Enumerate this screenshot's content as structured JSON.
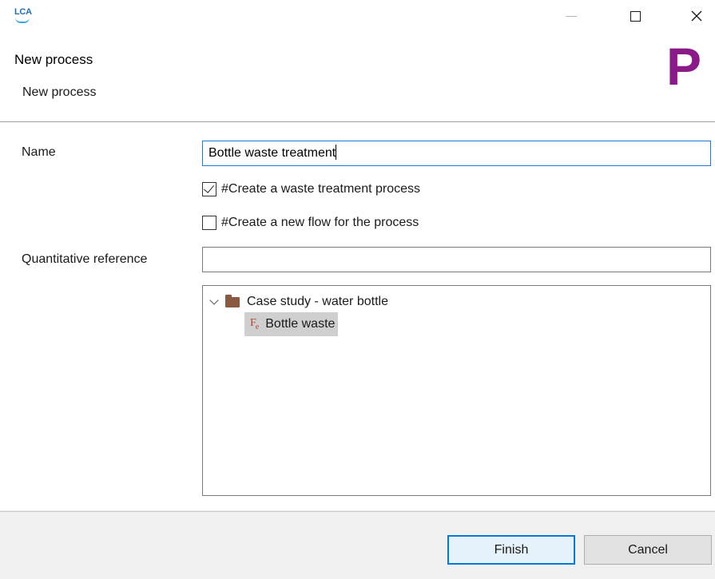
{
  "window": {
    "app_logo_text": "LCA",
    "minimize_icon": "minimize-icon",
    "maximize_icon": "maximize-icon",
    "close_icon": "close-icon",
    "close_glyph": "✕"
  },
  "header": {
    "title": "New process",
    "description": "New process",
    "glyph": "P",
    "glyph_color": "#8a1a87"
  },
  "form": {
    "name_label": "Name",
    "name_value": "Bottle waste treatment",
    "waste_checkbox_label": "#Create a waste treatment process",
    "waste_checkbox_checked": true,
    "new_flow_checkbox_label": "#Create a new flow for the process",
    "new_flow_checkbox_checked": false,
    "quantitative_reference_label": "Quantitative reference",
    "quantitative_reference_value": ""
  },
  "tree": {
    "folder": {
      "label": "Case study - water bottle",
      "icon": "folder-icon",
      "expanded": true
    },
    "flow": {
      "label": "Bottle waste",
      "icon": "flow-icon",
      "icon_glyph": "F",
      "icon_sub": "e",
      "selected": true
    }
  },
  "footer": {
    "finish_label": "Finish",
    "cancel_label": "Cancel"
  },
  "colors": {
    "accent": "#0078d7",
    "folder": "#8a5a40",
    "flow_icon": "#b24a2e",
    "selection": "#cfcfcf"
  }
}
